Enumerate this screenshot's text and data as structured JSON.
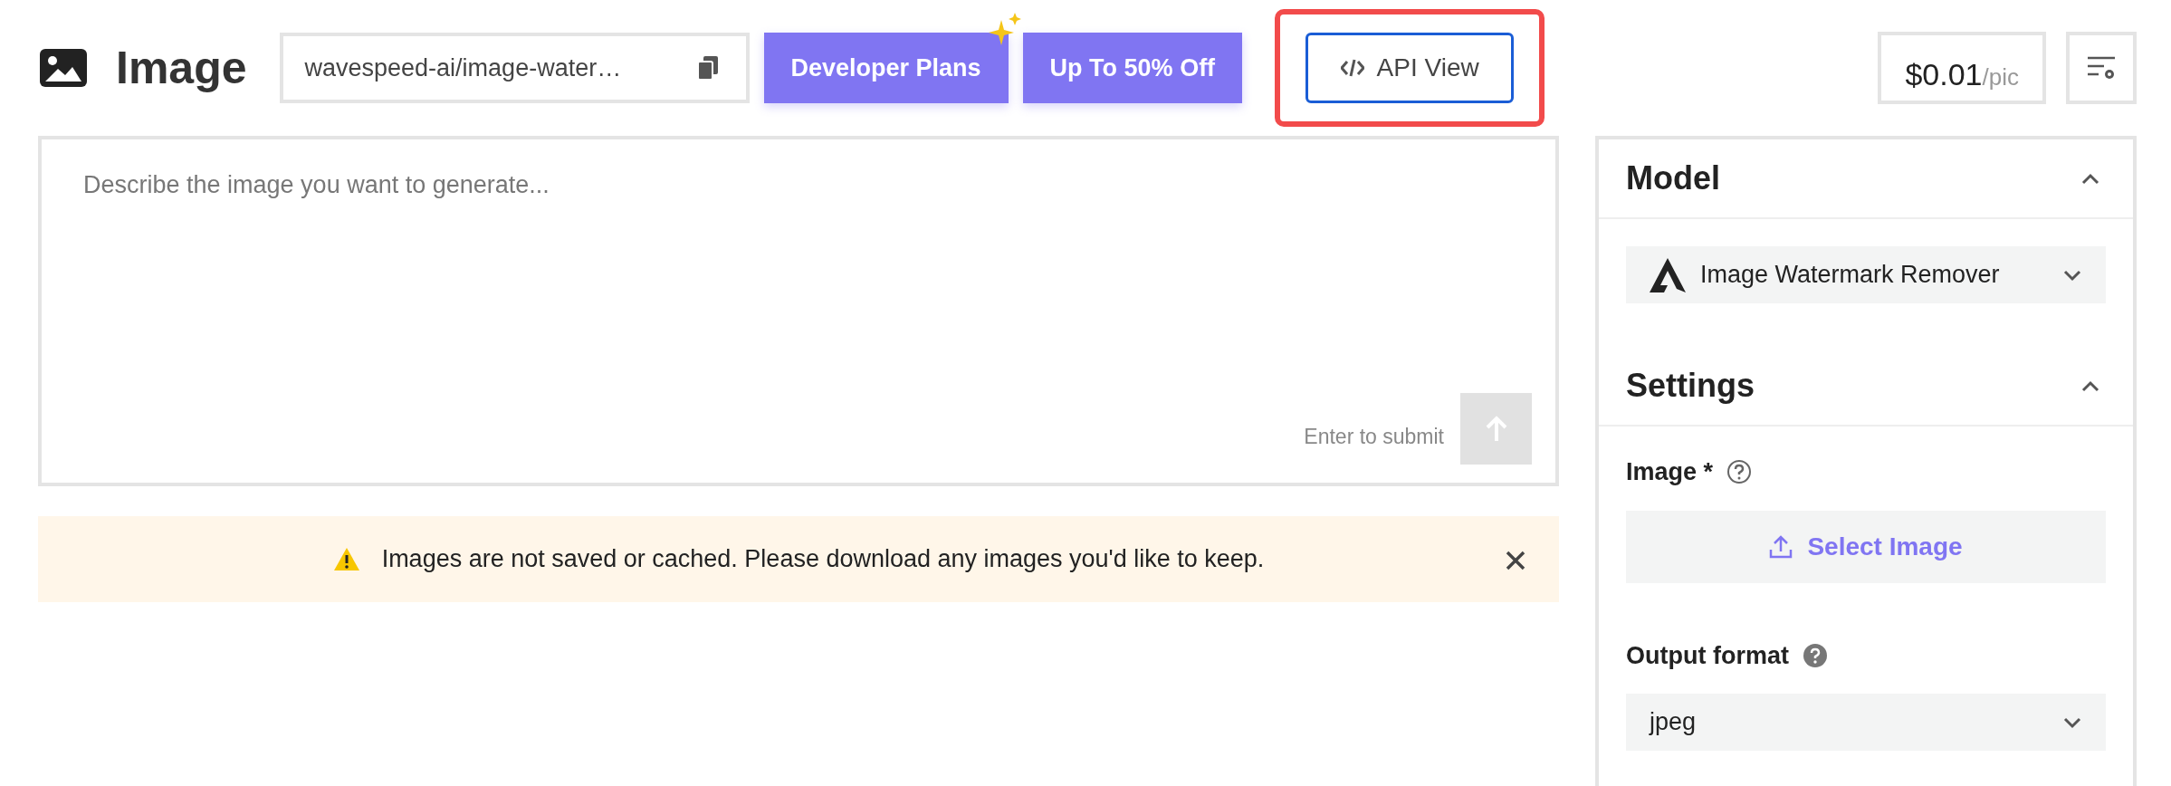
{
  "header": {
    "title": "Image",
    "model_path": "wavespeed-ai/image-water…",
    "buttons": [
      {
        "kind": "promo",
        "label": "Developer Plans",
        "sparkle": true
      },
      {
        "kind": "promo",
        "label": "Up To 50% Off",
        "sparkle": false
      },
      {
        "kind": "outline",
        "label": "API View",
        "highlighted": true
      }
    ],
    "price": {
      "amount": "$0.01",
      "unit": "/pic"
    }
  },
  "prompt": {
    "placeholder": "Describe the image you want to generate...",
    "hint": "Enter to submit",
    "submit_disabled": true
  },
  "notice": {
    "text": "Images are not saved or cached. Please download any images you'd like to keep."
  },
  "panel": {
    "sections": [
      {
        "title": "Model",
        "expanded": true
      },
      {
        "title": "Settings",
        "expanded": true
      }
    ],
    "model": {
      "name": "Image Watermark Remover"
    },
    "fields": [
      {
        "kind": "upload",
        "label": "Image *",
        "help_filled": false,
        "action": "Select Image"
      },
      {
        "kind": "select",
        "label": "Output format",
        "help_filled": true,
        "value": "jpeg"
      }
    ]
  }
}
